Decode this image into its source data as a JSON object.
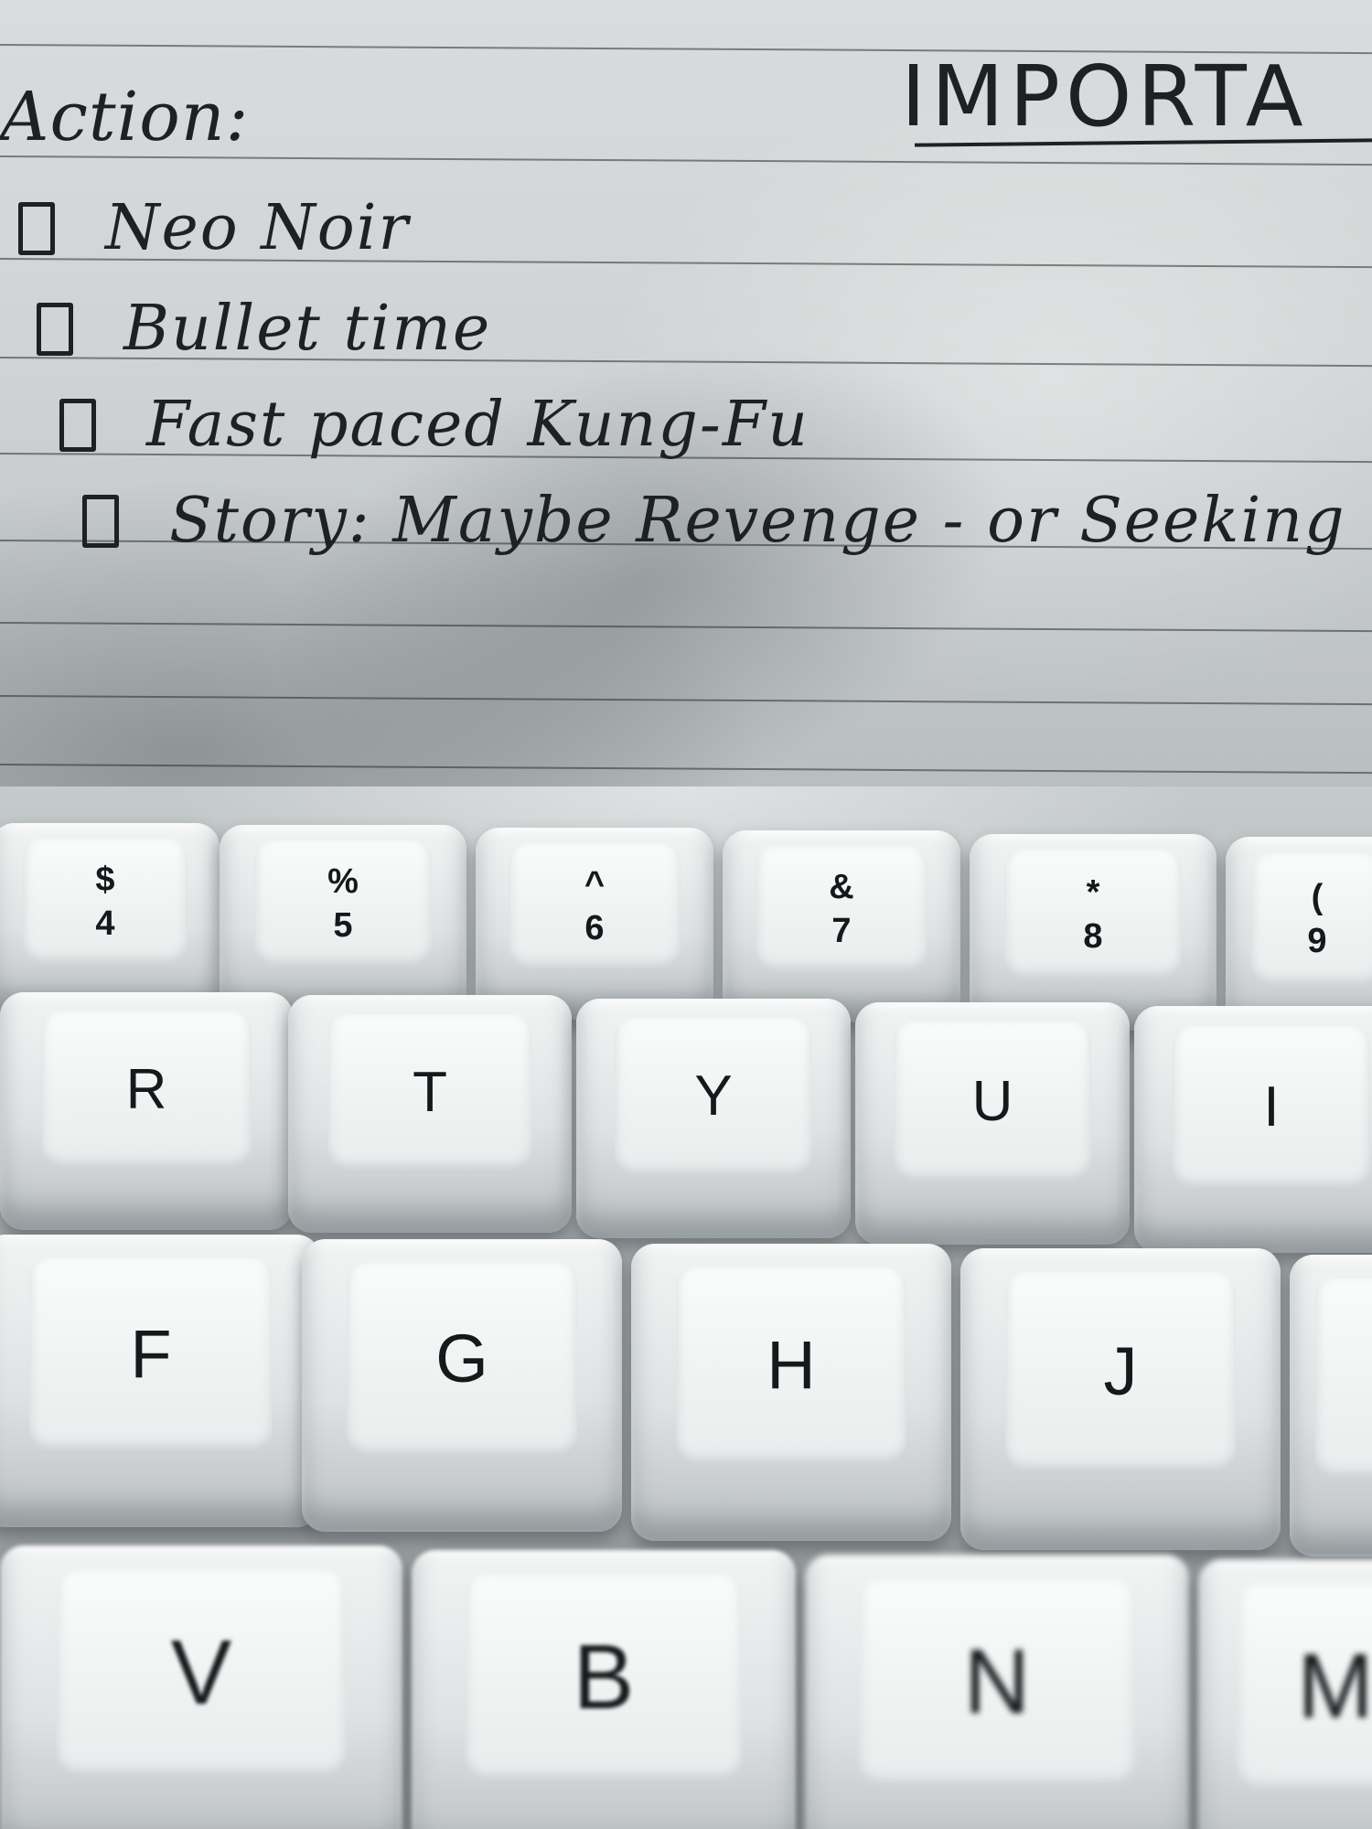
{
  "notebook": {
    "heading": "Action:",
    "important": "IMPORTA",
    "checklist": [
      {
        "text": "Neo Noir"
      },
      {
        "text": "Bullet time"
      },
      {
        "text": "Fast paced Kung-Fu"
      },
      {
        "text": "Story: Maybe Revenge - or Seeking"
      }
    ]
  },
  "keyboard": {
    "number_row": [
      {
        "shift": "$",
        "main": "4"
      },
      {
        "shift": "%",
        "main": "5"
      },
      {
        "shift": "^",
        "main": "6"
      },
      {
        "shift": "&",
        "main": "7"
      },
      {
        "shift": "*",
        "main": "8"
      },
      {
        "shift": "(",
        "main": "9"
      }
    ],
    "top_row": [
      "R",
      "T",
      "Y",
      "U",
      "I"
    ],
    "home_row": [
      "F",
      "G",
      "H",
      "J"
    ],
    "bottom_row": [
      "V",
      "B",
      "N",
      "M"
    ]
  },
  "colors": {
    "ink": "#1d2124",
    "paper": "#d9dcdc",
    "keycap": "#f2f4f4"
  }
}
